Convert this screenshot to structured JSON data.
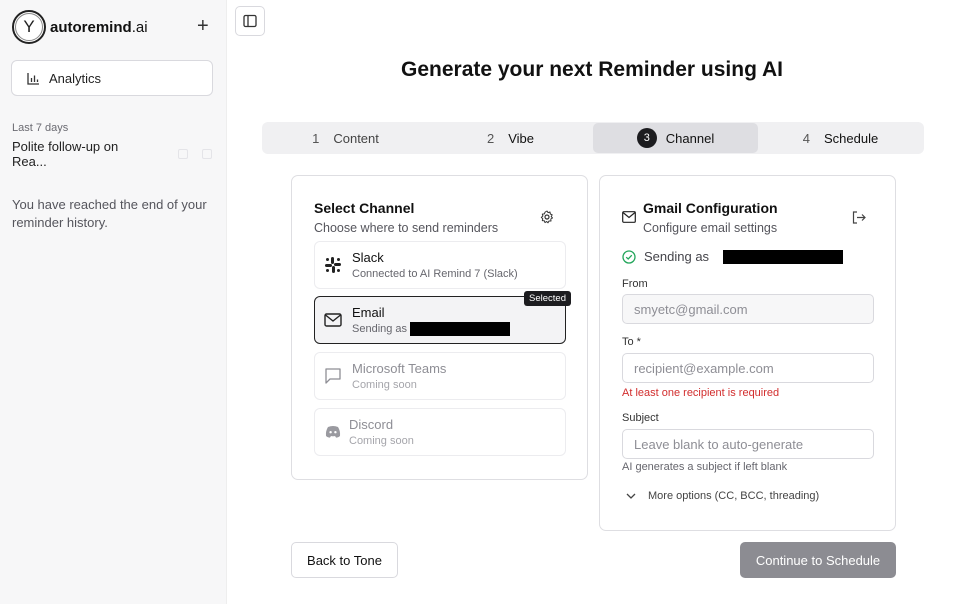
{
  "sidebar": {
    "brand": {
      "logo_letter": "Y",
      "name": "autoremind",
      "tld": ".ai"
    },
    "new_button": "+",
    "analytics_label": "Analytics",
    "section_label": "Last 7 days",
    "history": [
      {
        "title": "Polite follow-up on Rea..."
      }
    ],
    "end_note": "You have reached the end of your reminder history."
  },
  "main": {
    "title": "Generate your next Reminder using AI",
    "steps": [
      {
        "num": "1",
        "label": "Content"
      },
      {
        "num": "2",
        "label": "Vibe"
      },
      {
        "num": "3",
        "label": "Channel"
      },
      {
        "num": "4",
        "label": "Schedule"
      }
    ],
    "active_step": 3
  },
  "channel_card": {
    "title": "Select Channel",
    "subtitle": "Choose where to send reminders",
    "channels": [
      {
        "name": "Slack",
        "desc": "Connected to AI Remind 7 (Slack)",
        "icon": "slack-icon"
      },
      {
        "name": "Email",
        "desc": "Sending as",
        "icon": "mail-icon",
        "badge": "Selected"
      },
      {
        "name": "Microsoft Teams",
        "desc": "Coming soon",
        "icon": "chat-icon"
      },
      {
        "name": "Discord",
        "desc": "Coming soon",
        "icon": "discord-icon"
      }
    ]
  },
  "gmail_card": {
    "title": "Gmail Configuration",
    "subtitle": "Configure email settings",
    "sending_as": "Sending as",
    "from_label": "From",
    "from_value": "smyetc@gmail.com",
    "to_label": "To *",
    "to_placeholder": "recipient@example.com",
    "to_error": "At least one recipient is required",
    "subject_label": "Subject",
    "subject_placeholder": "Leave blank to auto-generate",
    "subject_hint": "AI generates a subject if left blank",
    "more_options": "More options (CC, BCC, threading)"
  },
  "actions": {
    "back": "Back to Tone",
    "next": "Continue to Schedule"
  },
  "colors": {
    "accent": "#1c1c1f",
    "error": "#d22d2d",
    "success": "#22a55a",
    "disabled_button": "#8c8c92"
  }
}
